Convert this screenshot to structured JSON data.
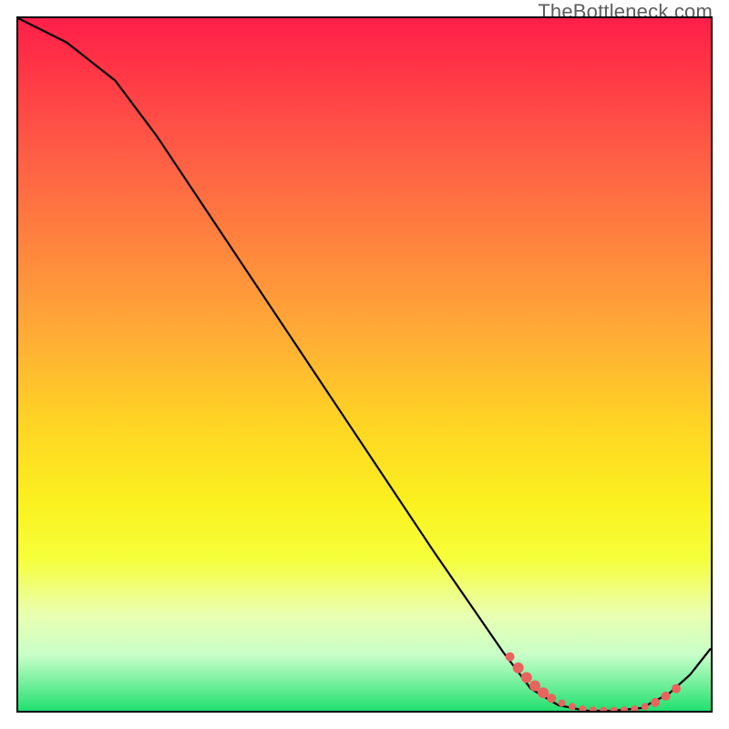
{
  "attribution": "TheBottleneck.com",
  "colors": {
    "frame": "#000000",
    "curve": "#000000",
    "dots": "#e9635f",
    "gradient_top": "#ff1f49",
    "gradient_bottom": "#21e070"
  },
  "chart_data": {
    "type": "line",
    "title": "",
    "xlabel": "",
    "ylabel": "",
    "xlim": [
      0,
      100
    ],
    "ylim": [
      0,
      100
    ],
    "grid": false,
    "legend": false,
    "curve": [
      {
        "x": 0,
        "y": 100
      },
      {
        "x": 7,
        "y": 96.5
      },
      {
        "x": 14,
        "y": 91
      },
      {
        "x": 20,
        "y": 83
      },
      {
        "x": 30,
        "y": 68
      },
      {
        "x": 40,
        "y": 53
      },
      {
        "x": 50,
        "y": 38
      },
      {
        "x": 60,
        "y": 23
      },
      {
        "x": 70,
        "y": 8.5
      },
      {
        "x": 74,
        "y": 3.2
      },
      {
        "x": 78,
        "y": 0.8
      },
      {
        "x": 82,
        "y": 0
      },
      {
        "x": 86,
        "y": 0
      },
      {
        "x": 90,
        "y": 0.4
      },
      {
        "x": 94,
        "y": 2.5
      },
      {
        "x": 97,
        "y": 5.2
      },
      {
        "x": 100,
        "y": 9
      }
    ],
    "dot_series": [
      {
        "x": 71.0,
        "y": 7.8,
        "r": 5
      },
      {
        "x": 72.2,
        "y": 6.2,
        "r": 6
      },
      {
        "x": 73.4,
        "y": 4.8,
        "r": 6
      },
      {
        "x": 74.6,
        "y": 3.6,
        "r": 6
      },
      {
        "x": 75.8,
        "y": 2.6,
        "r": 6
      },
      {
        "x": 77.0,
        "y": 1.8,
        "r": 5
      },
      {
        "x": 78.5,
        "y": 1.1,
        "r": 4
      },
      {
        "x": 80.0,
        "y": 0.6,
        "r": 4
      },
      {
        "x": 81.5,
        "y": 0.25,
        "r": 4
      },
      {
        "x": 83.0,
        "y": 0.1,
        "r": 4
      },
      {
        "x": 84.5,
        "y": 0.05,
        "r": 4
      },
      {
        "x": 86.0,
        "y": 0.05,
        "r": 4
      },
      {
        "x": 87.5,
        "y": 0.1,
        "r": 4
      },
      {
        "x": 89.0,
        "y": 0.25,
        "r": 4
      },
      {
        "x": 90.5,
        "y": 0.6,
        "r": 4
      },
      {
        "x": 92.0,
        "y": 1.2,
        "r": 5
      },
      {
        "x": 93.5,
        "y": 2.1,
        "r": 5
      },
      {
        "x": 95.0,
        "y": 3.2,
        "r": 5
      }
    ]
  }
}
